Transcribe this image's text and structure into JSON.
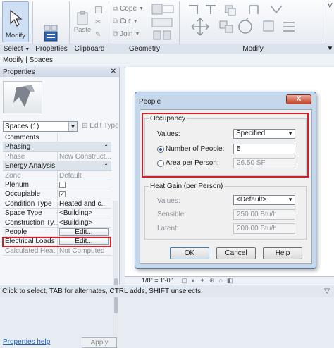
{
  "ribbon": {
    "modify_label": "Modify",
    "select_label": "Select",
    "properties_label": "Properties",
    "clipboard_label": "Clipboard",
    "geometry_label": "Geometry",
    "modify_group_label": "Modify",
    "paste_label": "Paste",
    "cope_label": "Cope",
    "cut_label": "Cut",
    "join_label": "Join",
    "edge_label": "V"
  },
  "modebar": {
    "text": "Modify | Spaces"
  },
  "properties": {
    "title": "Properties",
    "type_selector": "Spaces (1)",
    "edit_type": "Edit Type",
    "rows": [
      {
        "kind": "param",
        "name": "Comments",
        "value": ""
      },
      {
        "kind": "category",
        "name": "Phasing"
      },
      {
        "kind": "param",
        "name": "Phase",
        "value": "New Construct...",
        "grey": true
      },
      {
        "kind": "category",
        "name": "Energy Analysis"
      },
      {
        "kind": "param",
        "name": "Zone",
        "value": "Default",
        "grey": true
      },
      {
        "kind": "check",
        "name": "Plenum",
        "checked": false
      },
      {
        "kind": "check",
        "name": "Occupiable",
        "checked": true
      },
      {
        "kind": "param",
        "name": "Condition Type",
        "value": "Heated and c..."
      },
      {
        "kind": "param",
        "name": "Space Type",
        "value": "<Building>"
      },
      {
        "kind": "param",
        "name": "Construction Ty...",
        "value": "<Building>"
      },
      {
        "kind": "button",
        "name": "People",
        "value": "Edit..."
      },
      {
        "kind": "button",
        "name": "Electrical Loads",
        "value": "Edit..."
      },
      {
        "kind": "param",
        "name": "Calculated Heat ...",
        "value": "Not Computed",
        "grey": true
      }
    ],
    "help_link": "Properties help",
    "apply_label": "Apply"
  },
  "view_bar": {
    "scale": "1/8\" = 1'-0\""
  },
  "status": {
    "text": "Click to select, TAB for alternates, CTRL adds, SHIFT unselects."
  },
  "dialog": {
    "title": "People",
    "close_label": "X",
    "occupancy": {
      "legend": "Occupancy",
      "values_label": "Values:",
      "values_selected": "Specified",
      "num_people_label": "Number of People:",
      "num_people_value": "5",
      "area_per_person_label": "Area per Person:",
      "area_per_person_value": "26.50 SF"
    },
    "heat_gain": {
      "legend": "Heat Gain (per Person)",
      "values_label": "Values:",
      "values_selected": "<Default>",
      "sensible_label": "Sensible:",
      "sensible_value": "250.00 Btu/h",
      "latent_label": "Latent:",
      "latent_value": "200.00 Btu/h"
    },
    "ok_label": "OK",
    "cancel_label": "Cancel",
    "help_label": "Help"
  },
  "colors": {
    "highlight": "#d2202b",
    "accent": "#1e4f9c"
  }
}
